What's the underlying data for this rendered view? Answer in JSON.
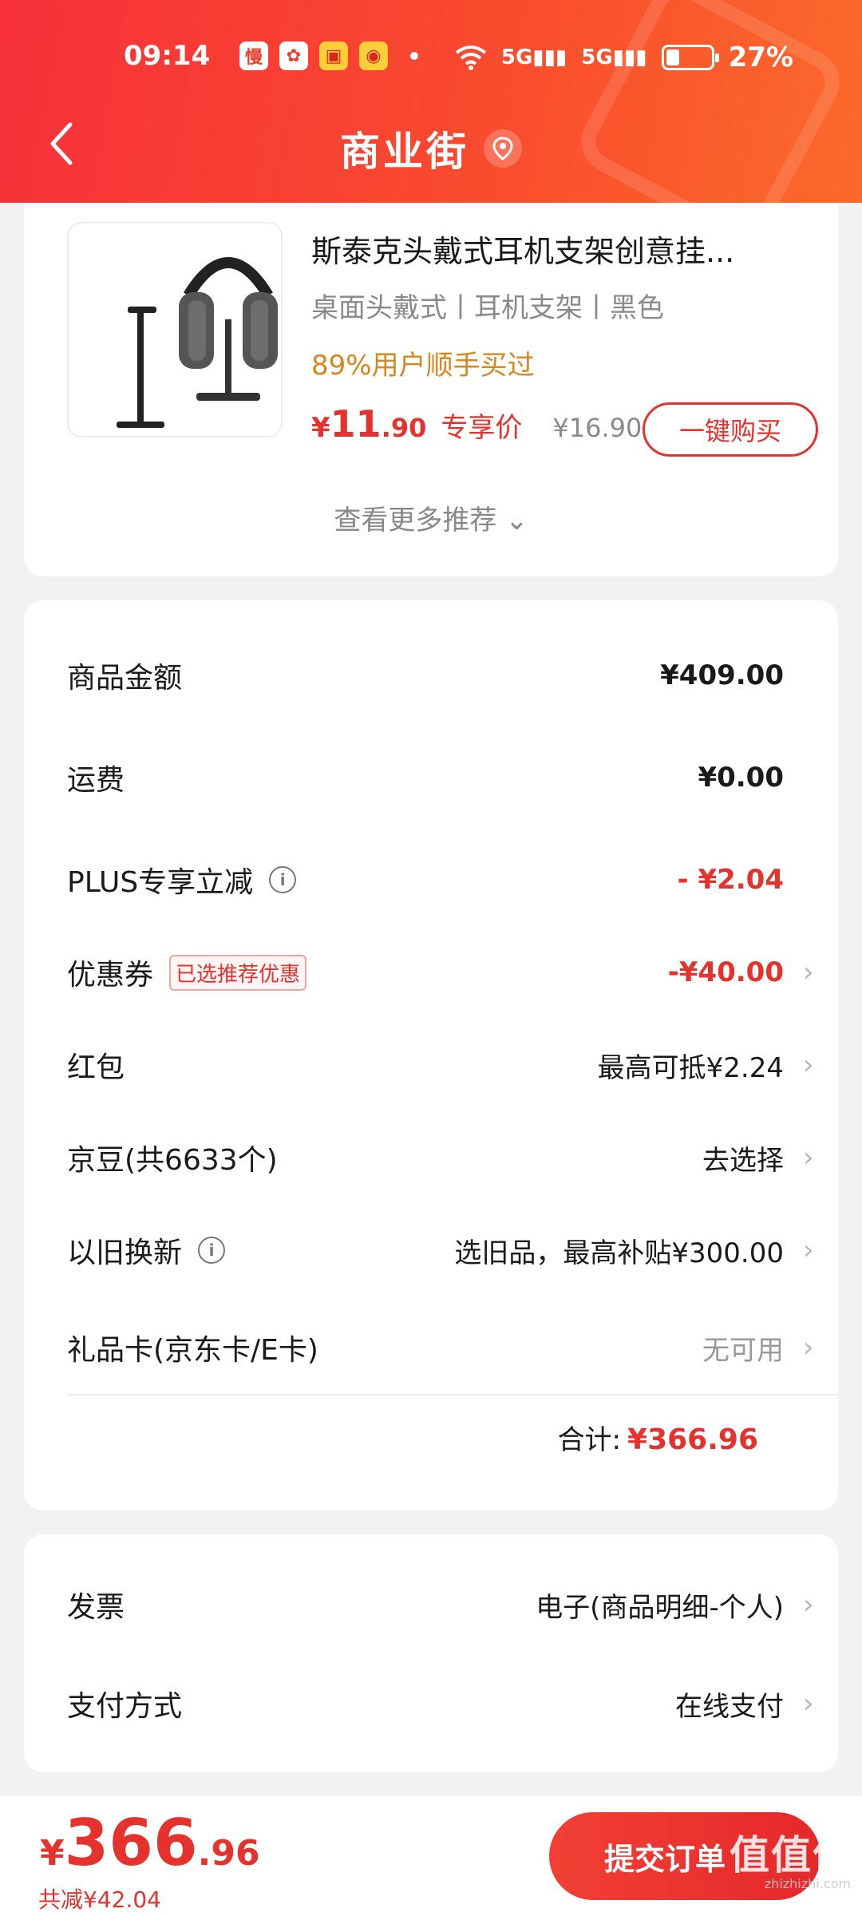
{
  "status": {
    "time": "09:14",
    "battery": "27%",
    "signal1": "5G",
    "signal2": "5G"
  },
  "nav": {
    "title": "商业街",
    "back_icon": "chevron-left-icon",
    "location_icon": "location-pin-icon"
  },
  "recommend": {
    "title": "斯泰克头戴式耳机支架创意挂...",
    "spec": "桌面头戴式丨耳机支架丨黑色",
    "tip": "89%用户顺手买过",
    "price_symbol": "¥",
    "price_int": "11",
    "price_dec": ".90",
    "price_tag": "专享价",
    "orig_price": "¥16.90",
    "buy_label": "一键购买",
    "more_label": "查看更多推荐"
  },
  "summary": {
    "rows": [
      {
        "label": "商品金额",
        "value": "¥409.00"
      },
      {
        "label": "运费",
        "value": "¥0.00"
      },
      {
        "label": "PLUS专享立减",
        "value": "- ¥2.04"
      },
      {
        "label": "优惠券",
        "badge": "已选推荐优惠",
        "value": "-¥40.00"
      },
      {
        "label": "红包",
        "value": "最高可抵¥2.24"
      },
      {
        "label": "京豆(共6633个)",
        "value": "去选择"
      },
      {
        "label": "以旧换新",
        "value": "选旧品，最高补贴¥300.00"
      },
      {
        "label": "礼品卡(京东卡/E卡)",
        "value": "无可用"
      }
    ],
    "total_label": "合计:",
    "total_value": "¥366.96"
  },
  "other": {
    "invoice_label": "发票",
    "invoice_value": "电子(商品明细-个人)",
    "payment_label": "支付方式",
    "payment_value": "在线支付"
  },
  "footer": {
    "price_symbol": "¥",
    "price_int": "366",
    "price_dec": ".96",
    "saved": "共减¥42.04",
    "submit_label": "提交订单",
    "watermark": "值值值",
    "watermark_sub": "zhizhizhi.com"
  },
  "colors": {
    "brand": "#f7303a",
    "price_red": "#e5322d",
    "tip_orange": "#d9861a"
  }
}
